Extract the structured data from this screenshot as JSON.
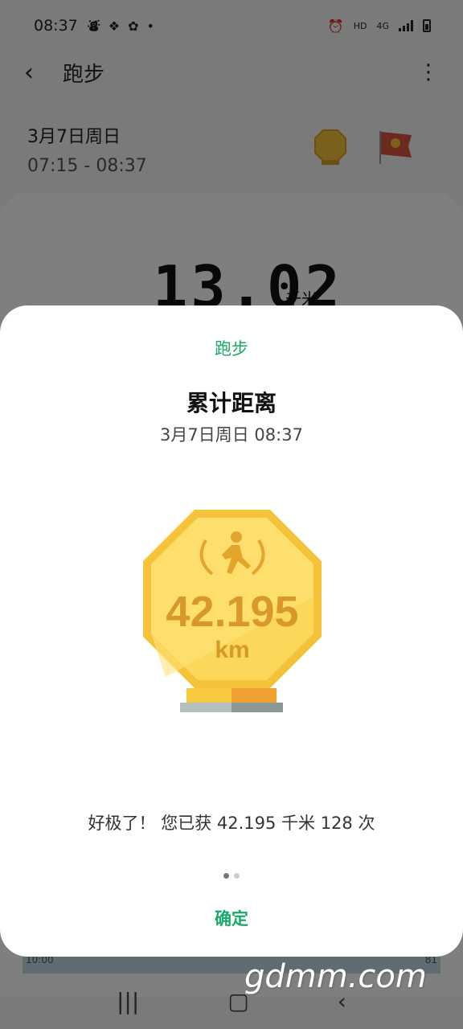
{
  "status_bar": {
    "time": "08:37",
    "network_hd": "HD",
    "network_4g": "4G"
  },
  "app_bar": {
    "title": "跑步"
  },
  "session": {
    "date": "3月7日周日",
    "time_range": "07:15 - 08:37",
    "distance": "13.02",
    "distance_unit": "千米"
  },
  "chart": {
    "x_start": "10:00",
    "x_end": "81"
  },
  "dialog": {
    "category": "跑步",
    "title": "累计距离",
    "datetime": "3月7日周日 08:37",
    "medal_value": "42.195",
    "medal_unit": "km",
    "message": "好极了！ 您已获 42.195 千米 128 次",
    "confirm_label": "确定",
    "page_count": 2,
    "active_page": 1
  },
  "watermark": "gdmm.com",
  "colors": {
    "accent": "#1ba86a",
    "gold": "#f5c33a"
  }
}
